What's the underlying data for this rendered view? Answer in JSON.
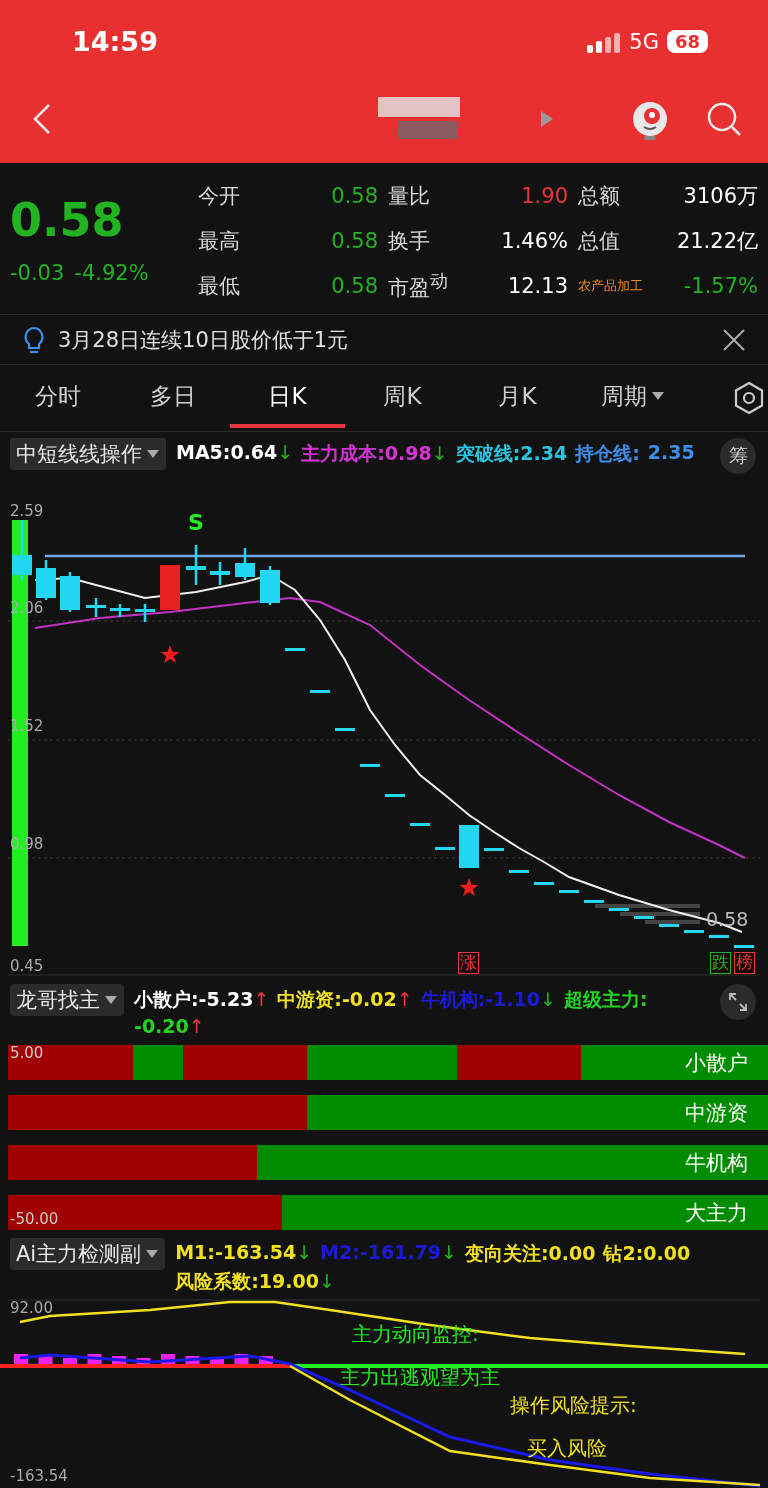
{
  "status_bar": {
    "time": "14:59",
    "network": "5G",
    "battery": "68"
  },
  "quote": {
    "price": "0.58",
    "change": "-0.03",
    "change_pct": "-4.92%",
    "color": "#22b322",
    "rows": [
      [
        {
          "label": "今开",
          "value": "0.58",
          "color": "#22b322"
        },
        {
          "label": "量比",
          "value": "1.90",
          "color": "#e8333a"
        },
        {
          "label": "总额",
          "value": "3106万",
          "color": "#ffffff"
        }
      ],
      [
        {
          "label": "最高",
          "value": "0.58",
          "color": "#22b322"
        },
        {
          "label": "换手",
          "value": "1.46%",
          "color": "#ffffff"
        },
        {
          "label": "总值",
          "value": "21.22亿",
          "color": "#ffffff"
        }
      ],
      [
        {
          "label": "最低",
          "value": "0.58",
          "color": "#22b322"
        },
        {
          "label": "市盈$^{动}$",
          "value": "12.13",
          "color": "#ffffff"
        },
        {
          "label": "农产品加工",
          "value": "-1.57%",
          "color": "#22b322",
          "kind": "sector"
        }
      ]
    ]
  },
  "notice": {
    "text": "3月28日连续10日股价低于1元"
  },
  "tabs": [
    {
      "label": "分时",
      "selected": false
    },
    {
      "label": "多日",
      "selected": false
    },
    {
      "label": "日K",
      "selected": true
    },
    {
      "label": "周K",
      "selected": false
    },
    {
      "label": "月K",
      "selected": false
    },
    {
      "label": "周期",
      "selected": false,
      "kind": "dropdown"
    }
  ],
  "main_indicator": {
    "name": "中短线线操作",
    "button": "筹",
    "items": [
      {
        "text": "MA5:0.64",
        "arrow": "↓",
        "rising": false,
        "color": "#ffffff"
      },
      {
        "text": "主力成本:0.98",
        "arrow": "↓",
        "rising": false,
        "color": "#d633d6"
      },
      {
        "text": "突破线:2.34",
        "color": "#29c4e0"
      },
      {
        "text": "持仓线:",
        "color": "#3b8fe8"
      },
      {
        "text": "2.35",
        "color": "#3b8fe8"
      }
    ]
  },
  "main_chart": {
    "axis_labels": [
      "2.59",
      "2.06",
      "1.52",
      "0.98",
      "0.45"
    ],
    "last_price": "0.58",
    "signal": "S",
    "markers": [
      {
        "text": "涨",
        "kind": "rise"
      },
      {
        "text": "跌",
        "kind": "fall"
      },
      {
        "text": "榜",
        "kind": "rise"
      }
    ]
  },
  "force_indicator": {
    "name": "龙哥找主",
    "items": [
      {
        "text": "小散户:-5.23",
        "arrow": "↑",
        "rising": true,
        "color": "#ffffff"
      },
      {
        "text": "中游资:-0.02",
        "arrow": "↑",
        "rising": true,
        "color": "#f0e020"
      },
      {
        "text": "牛机构:-1.10",
        "arrow": "↓",
        "rising": false,
        "color": "#1a1ad8"
      },
      {
        "text": "超级主力:",
        "color": "#22d422"
      },
      {
        "text": "-0.20",
        "arrow": "↑",
        "rising": true,
        "color": "#22d422"
      }
    ]
  },
  "force_bars": {
    "top_label": "5.00",
    "bottom_label": "-50.00",
    "rows": [
      {
        "label": "小散户"
      },
      {
        "label": "中游资"
      },
      {
        "label": "牛机构"
      },
      {
        "label": "大主力"
      }
    ]
  },
  "ai_indicator": {
    "name": "Ai主力检测副",
    "items": [
      {
        "text": "M1:-163.54",
        "arrow": "↓",
        "rising": false,
        "color": "#f0e020"
      },
      {
        "text": "M2:-161.79",
        "arrow": "↓",
        "rising": false,
        "color": "#1a1ad8"
      },
      {
        "text": "变向关注:0.00",
        "color": "#f0e020"
      },
      {
        "text": "钻2:0.00",
        "color": "#f0e020"
      },
      {
        "text": "风险系数:19.00",
        "arrow": "↓",
        "rising": false,
        "color": "#f0e020"
      }
    ]
  },
  "ai_chart": {
    "top_label": "92.00",
    "bottom_label": "-163.54",
    "notes": [
      {
        "text": "主力动向监控:",
        "kind": "trend"
      },
      {
        "text": "主力出逃观望为主",
        "kind": "trend"
      },
      {
        "text": "操作风险提示:",
        "kind": "risk"
      },
      {
        "text": "买入风险",
        "kind": "risk"
      }
    ]
  }
}
